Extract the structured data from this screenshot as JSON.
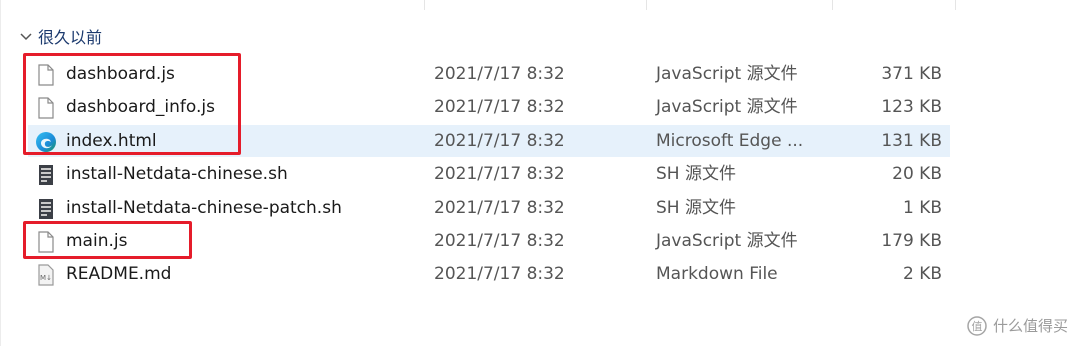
{
  "group": {
    "label": "很久以前"
  },
  "files": [
    {
      "name": "dashboard.js",
      "modified": "2021/7/17 8:32",
      "type": "JavaScript 源文件",
      "size": "371 KB",
      "icon": "js-file-icon",
      "selected": false
    },
    {
      "name": "dashboard_info.js",
      "modified": "2021/7/17 8:32",
      "type": "JavaScript 源文件",
      "size": "123 KB",
      "icon": "js-file-icon",
      "selected": false
    },
    {
      "name": "index.html",
      "modified": "2021/7/17 8:32",
      "type": "Microsoft Edge ...",
      "size": "131 KB",
      "icon": "edge-icon",
      "selected": true
    },
    {
      "name": "install-Netdata-chinese.sh",
      "modified": "2021/7/17 8:32",
      "type": "SH 源文件",
      "size": "20 KB",
      "icon": "shell-file-icon",
      "selected": false
    },
    {
      "name": "install-Netdata-chinese-patch.sh",
      "modified": "2021/7/17 8:32",
      "type": "SH 源文件",
      "size": "1 KB",
      "icon": "shell-file-icon",
      "selected": false
    },
    {
      "name": "main.js",
      "modified": "2021/7/17 8:32",
      "type": "JavaScript 源文件",
      "size": "179 KB",
      "icon": "js-file-icon",
      "selected": false
    },
    {
      "name": "README.md",
      "modified": "2021/7/17 8:32",
      "type": "Markdown File",
      "size": "2 KB",
      "icon": "markdown-file-icon",
      "selected": false
    }
  ],
  "colors": {
    "highlight_box": "#e51c2a",
    "selection": "#e6f1fb",
    "group_header": "#1c3a6e"
  },
  "watermark": {
    "text": "什么值得买"
  }
}
